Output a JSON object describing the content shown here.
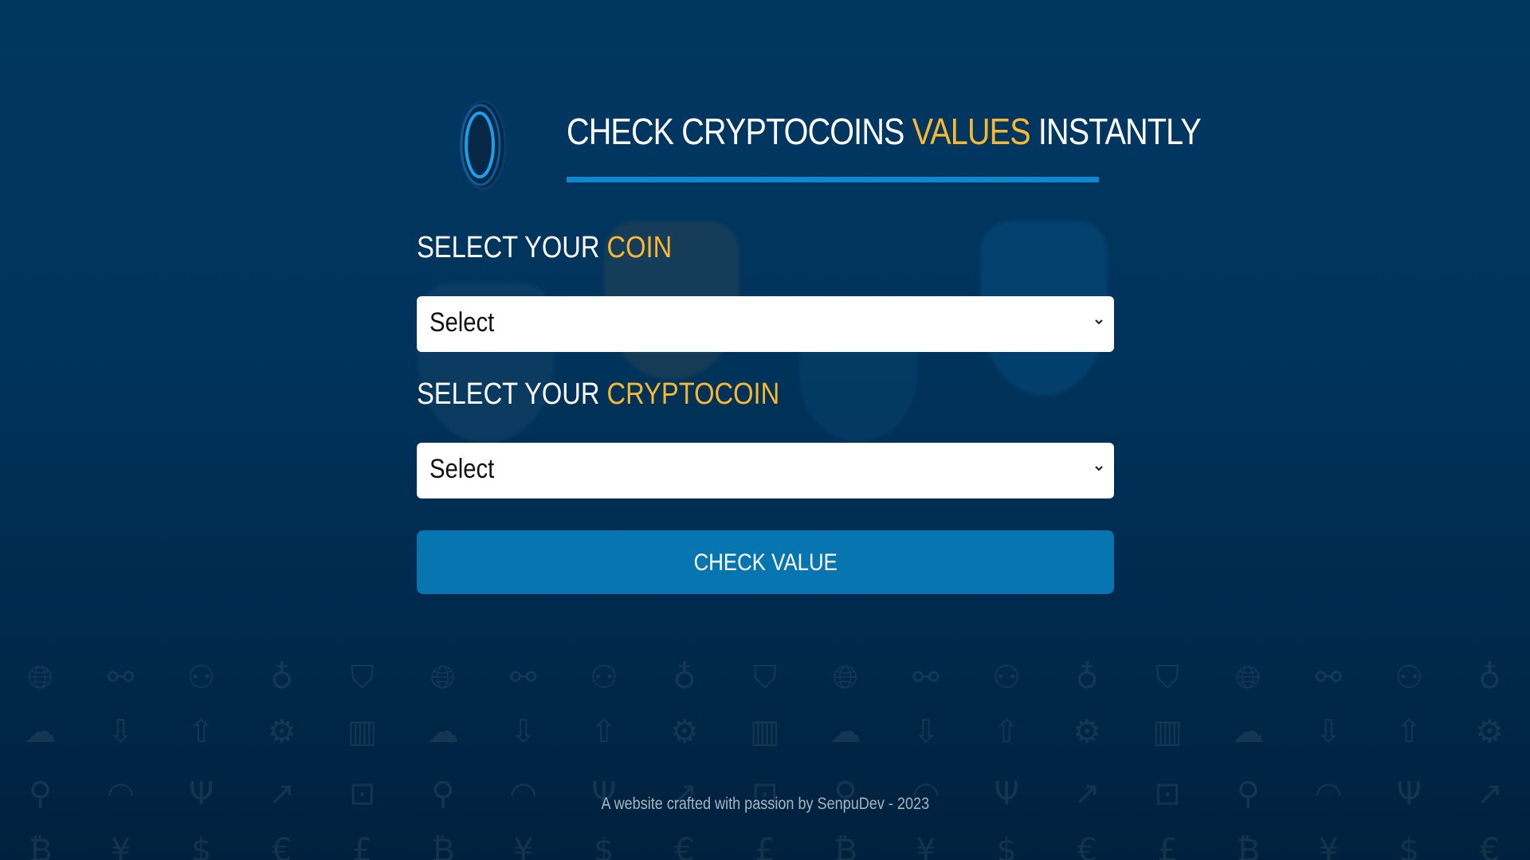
{
  "header": {
    "title_part1": "CHECK CRYPTOCOINS ",
    "title_accent": "VALUES",
    "title_part2": " INSTANTLY",
    "logo_icon": "coin-icon"
  },
  "form": {
    "coin_label_part1": "SELECT YOUR ",
    "coin_label_accent": "COIN",
    "coin_select_value": "Select",
    "crypto_label_part1": "SELECT YOUR ",
    "crypto_label_accent": "CRYPTOCOIN",
    "crypto_select_value": "Select",
    "check_button_label": "CHECK VALUE"
  },
  "footer": {
    "text": "A website crafted with passion by SenpuDev - 2023"
  },
  "colors": {
    "accent": "#f7b733",
    "button": "#0675b0",
    "underline": "#1187d0",
    "background_top": "#003761",
    "background_bottom": "#00213e"
  },
  "background_icons": [
    "globe-icon",
    "link-icon",
    "nodes-icon",
    "bag-icon",
    "shield-icon",
    "cloud-icon",
    "cloud-download-icon",
    "cloud-upload-icon",
    "gear-icon",
    "bar-chart-icon",
    "location-icon",
    "wifi-icon",
    "plug-icon",
    "trend-up-icon",
    "lock-icon",
    "bitcoin-icon",
    "yen-icon",
    "dollar-icon",
    "euro-icon",
    "pound-icon"
  ]
}
